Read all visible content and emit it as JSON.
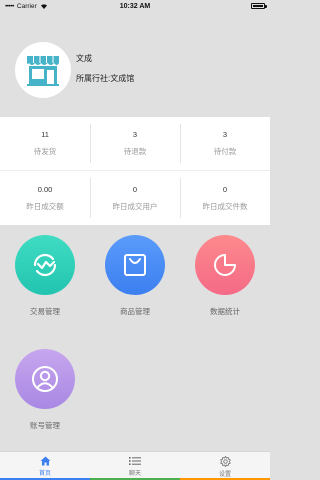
{
  "status_bar": {
    "carrier": "Carrier",
    "time": "10:32 AM"
  },
  "profile": {
    "shop_name": "文成",
    "cooperative": "所属行社:文成馆"
  },
  "stats_row1": [
    {
      "value": "11",
      "label": "待发货"
    },
    {
      "value": "3",
      "label": "待退款"
    },
    {
      "value": "3",
      "label": "待付款"
    }
  ],
  "stats_row2": [
    {
      "value": "0.00",
      "label": "昨日成交额"
    },
    {
      "value": "0",
      "label": "昨日成交用户"
    },
    {
      "value": "0",
      "label": "昨日成交件数"
    }
  ],
  "menu": [
    {
      "label": "交易管理",
      "icon": "transaction-icon",
      "color": "#2fd0bb"
    },
    {
      "label": "商品管理",
      "icon": "shopping-bag-icon",
      "color": "#4a8df6"
    },
    {
      "label": "数据统计",
      "icon": "pie-chart-icon",
      "color": "#f97b8a"
    },
    {
      "label": "账号管理",
      "icon": "user-icon",
      "color": "#b697ea"
    }
  ],
  "tabs": [
    {
      "label": "首页",
      "icon": "home-icon",
      "accent": "#3c7ff0"
    },
    {
      "label": "聊天",
      "icon": "list-icon",
      "accent": "#4caf50"
    },
    {
      "label": "设置",
      "icon": "gear-icon",
      "accent": "#ff9800"
    }
  ]
}
